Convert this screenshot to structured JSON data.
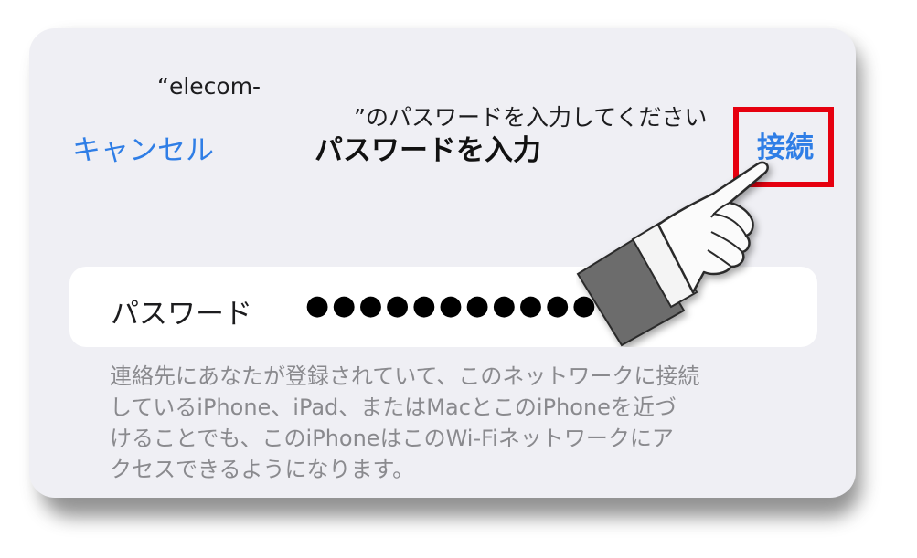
{
  "dialog": {
    "prompt_open": "“elecom-",
    "prompt_close": "”のパスワードを入力してください",
    "cancel_label": "キャンセル",
    "title": "パスワードを入力",
    "connect_label": "接続"
  },
  "password_field": {
    "label": "パスワード",
    "value": "●●●●●●●●●●●"
  },
  "note": [
    "連絡先にあなたが登録されていて、このネットワークに接続",
    "しているiPhone、iPad、またはMacとこのiPhoneを近づ",
    "けることでも、このiPhoneはこのWi-Fiネットワークにア",
    "クセスできるようになります。"
  ],
  "colors": {
    "accent": "#2f7ee6",
    "highlight": "#e6000f",
    "sheet_background": "#efeff4"
  },
  "icons": {
    "pointer": "pointing-hand-icon"
  }
}
